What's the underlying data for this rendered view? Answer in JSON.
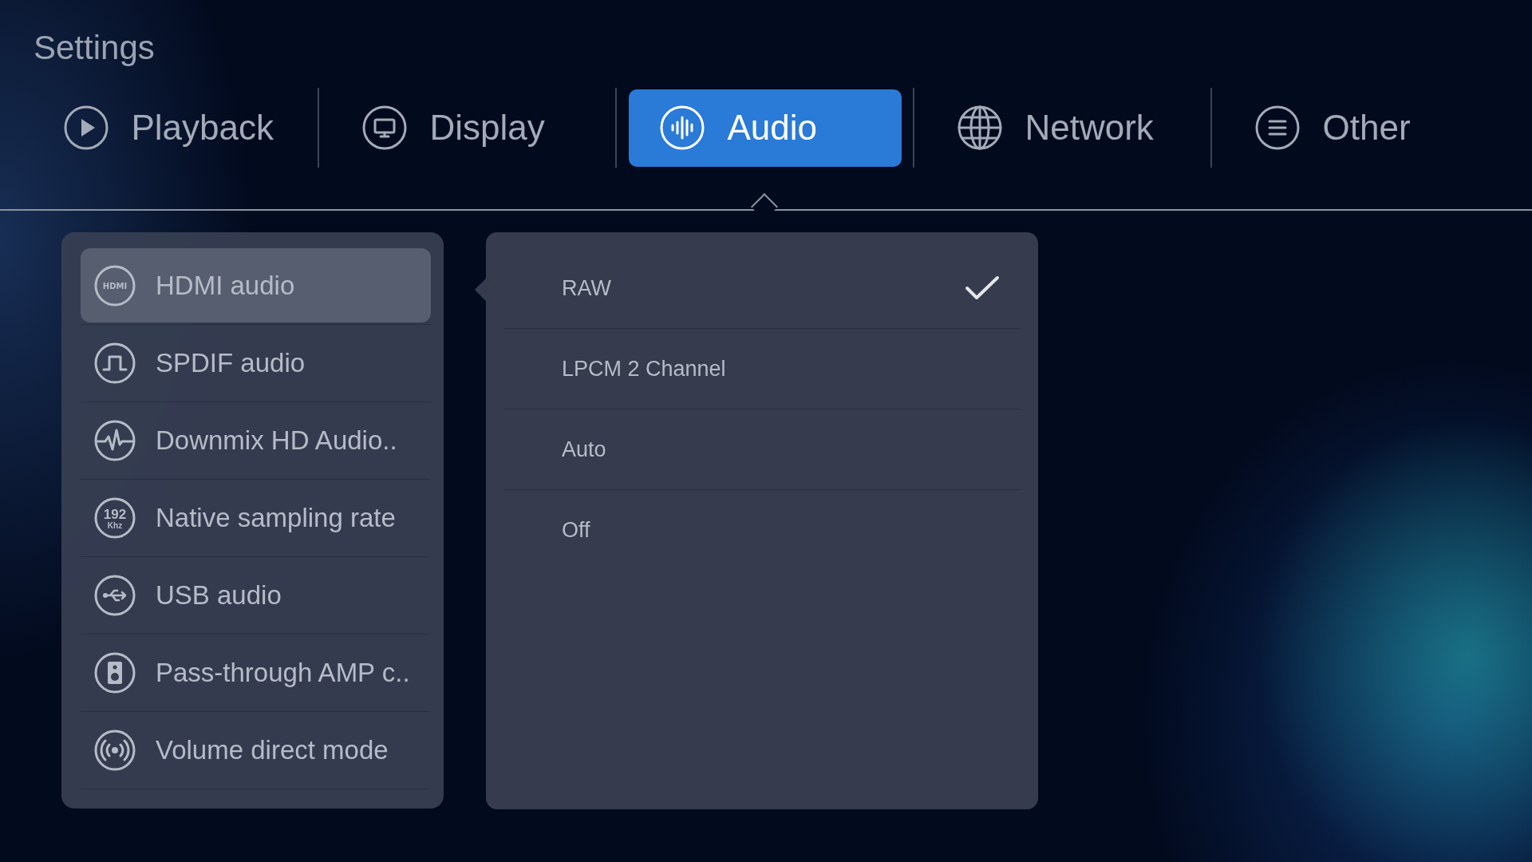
{
  "title": "Settings",
  "tabs": [
    {
      "label": "Playback",
      "kind": "play",
      "selected": false
    },
    {
      "label": "Display",
      "kind": "monitor",
      "selected": false
    },
    {
      "label": "Audio",
      "kind": "levels",
      "selected": true
    },
    {
      "label": "Network",
      "kind": "globe",
      "selected": false
    },
    {
      "label": "Other",
      "kind": "menu",
      "selected": false
    }
  ],
  "settings": [
    {
      "label": "HDMI audio",
      "kind": "hdmi",
      "icon_text": [
        "HDMI"
      ],
      "selected": true
    },
    {
      "label": "SPDIF audio",
      "kind": "square-wave",
      "selected": false
    },
    {
      "label": "Downmix HD Audio..",
      "kind": "pulse",
      "selected": false
    },
    {
      "label": "Native sampling rate",
      "kind": "rate",
      "icon_text": [
        "192",
        "Khz"
      ],
      "selected": false
    },
    {
      "label": "USB audio",
      "kind": "usb",
      "selected": false
    },
    {
      "label": "Pass-through AMP c..",
      "kind": "speaker",
      "selected": false
    },
    {
      "label": "Volume direct mode",
      "kind": "broadcast",
      "selected": false
    }
  ],
  "options": [
    {
      "label": "RAW",
      "selected": true
    },
    {
      "label": "LPCM 2 Channel",
      "selected": false
    },
    {
      "label": "Auto",
      "selected": false
    },
    {
      "label": "Off",
      "selected": false
    }
  ]
}
